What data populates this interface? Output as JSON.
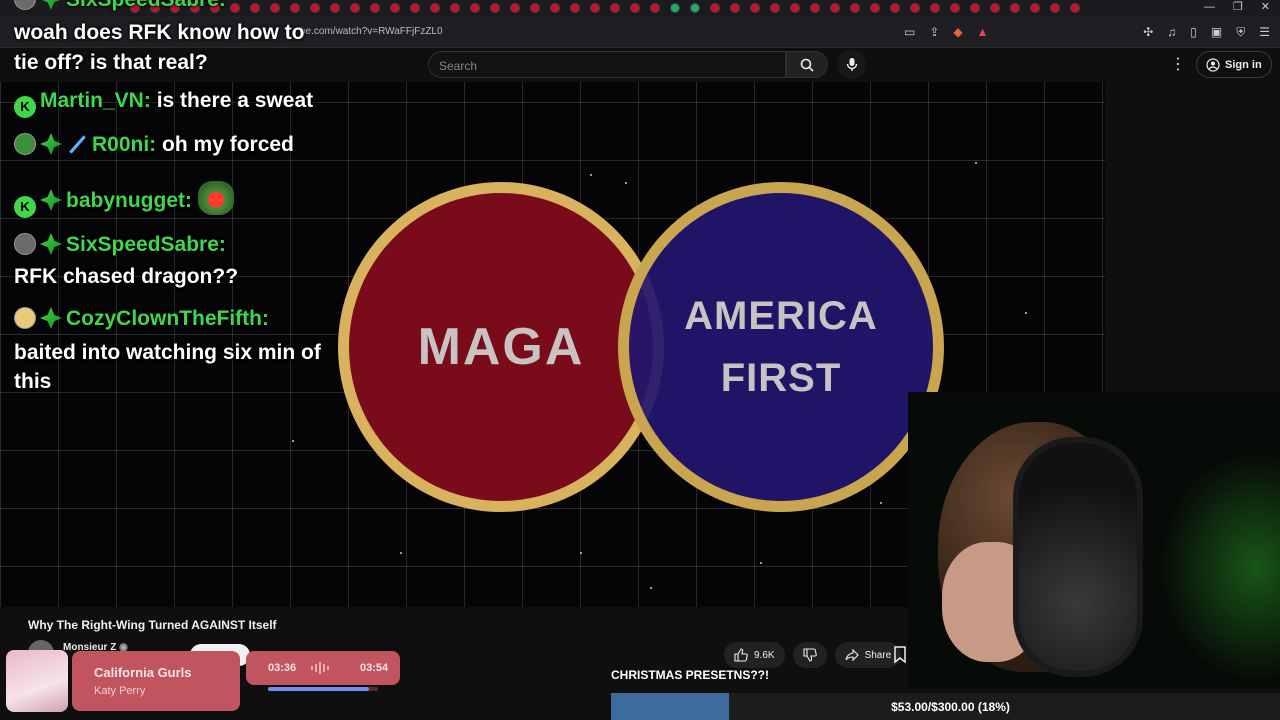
{
  "browser": {
    "url": "be.com/watch?v=RWaFFjFzZL0",
    "window_controls": [
      "—",
      "❐",
      "✕"
    ]
  },
  "header": {
    "search_placeholder": "Search",
    "sign_in_label": "Sign in"
  },
  "chat": {
    "messages": [
      {
        "user": "SixSpeedSabre:",
        "text": ""
      },
      {
        "user": "",
        "text": "woah does RFK know how to tie off? is that real?"
      },
      {
        "user": "Martin_VN:",
        "text": "is there a sweat"
      },
      {
        "user": "R00ni:",
        "text": "oh my forced"
      },
      {
        "user": "babynugget:",
        "text": ""
      },
      {
        "user": "SixSpeedSabre:",
        "text": "RFK chased dragon??"
      },
      {
        "user": "CozyClownTheFifth:",
        "text": "baited into watching six min of this"
      }
    ]
  },
  "video": {
    "circle_left_text": "MAGA",
    "circle_right_text": "AMERICA FIRST",
    "title": "Why The Right-Wing Turned AGAINST Itself",
    "channel": "Monsieur Z",
    "like_count": "9.6K",
    "share_label": "Share"
  },
  "music": {
    "title": "California Gurls",
    "artist": "Katy Perry",
    "current_time": "03:36",
    "total_time": "03:54",
    "progress": 0.92
  },
  "goal": {
    "label": "CHRISTMAS PRESETNS??!",
    "text": "$53.00/$300.00 (18%)",
    "progress": 0.177
  },
  "colors": {
    "chat_username": "#3ed84a",
    "maga_circle": "#7a0b1a",
    "america_first_circle": "#22166e",
    "circle_border": "#d8b25c",
    "music_card": "#c0555f",
    "goal_fill": "#3d6b9e"
  }
}
